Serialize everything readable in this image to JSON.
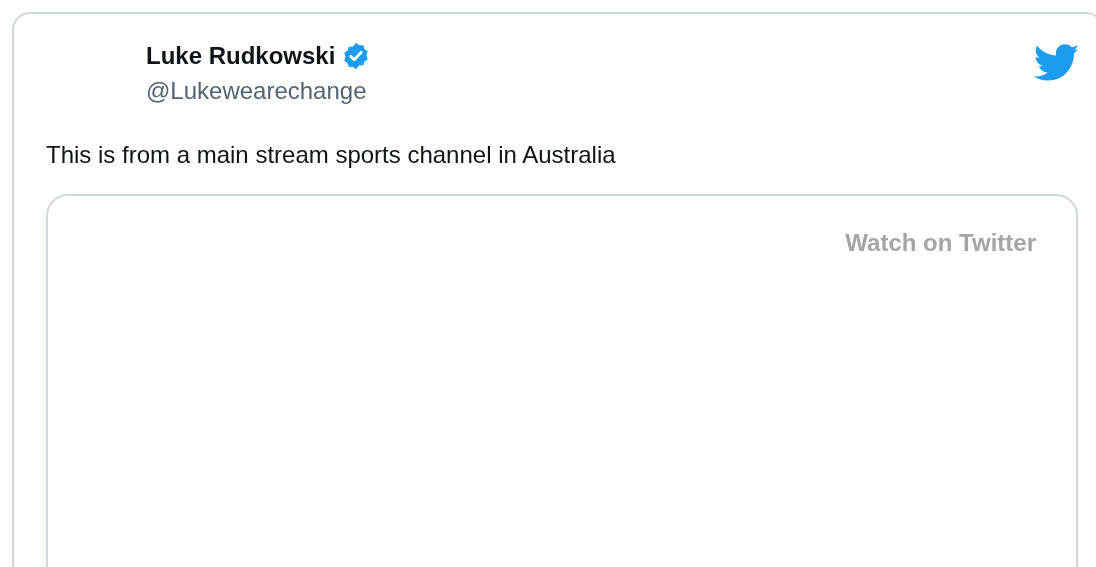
{
  "tweet": {
    "author": {
      "name": "Luke Rudkowski",
      "verified": true,
      "handle": "@Lukewearechange"
    },
    "text": "This is from a main stream sports channel in Australia",
    "media": {
      "kind": "video",
      "link": "Watch on Twitter"
    }
  }
}
